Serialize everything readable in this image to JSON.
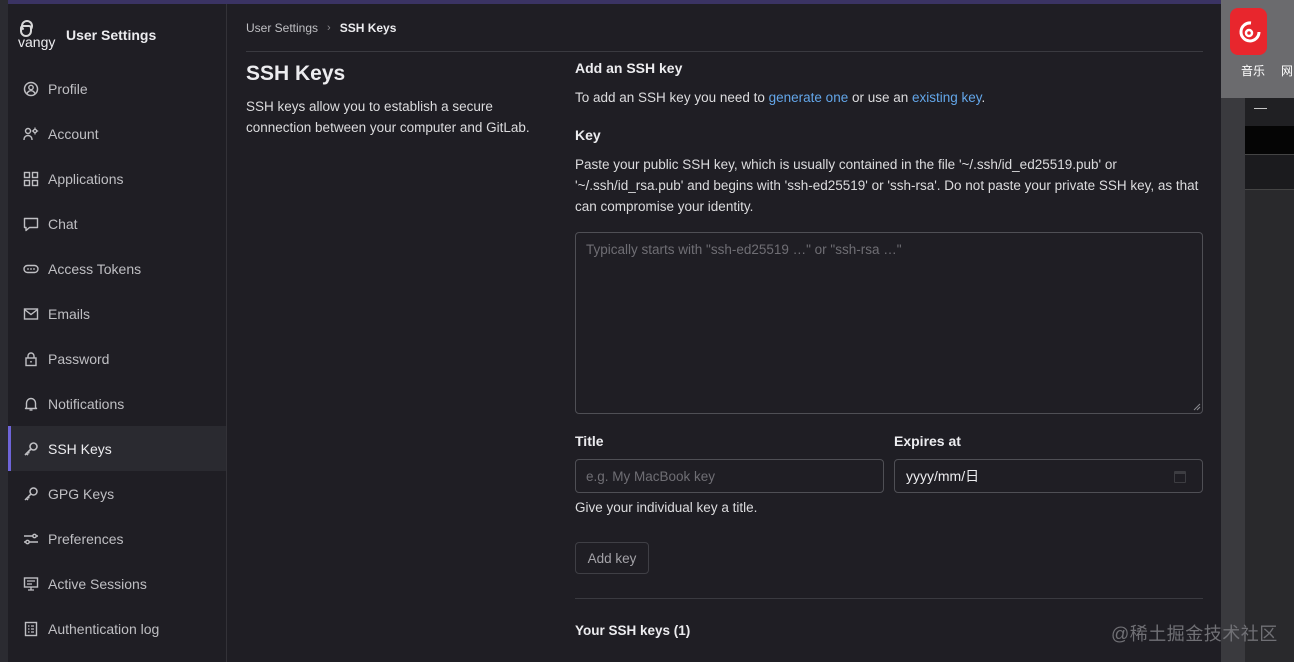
{
  "sidebar": {
    "avatar_alt": "vangy",
    "title": "User Settings",
    "items": [
      {
        "label": "Profile",
        "icon": "profile-icon"
      },
      {
        "label": "Account",
        "icon": "account-icon"
      },
      {
        "label": "Applications",
        "icon": "applications-icon"
      },
      {
        "label": "Chat",
        "icon": "chat-icon"
      },
      {
        "label": "Access Tokens",
        "icon": "token-icon"
      },
      {
        "label": "Emails",
        "icon": "mail-icon"
      },
      {
        "label": "Password",
        "icon": "lock-icon"
      },
      {
        "label": "Notifications",
        "icon": "bell-icon"
      },
      {
        "label": "SSH Keys",
        "icon": "key-icon",
        "active": true
      },
      {
        "label": "GPG Keys",
        "icon": "key-icon"
      },
      {
        "label": "Preferences",
        "icon": "preferences-icon"
      },
      {
        "label": "Active Sessions",
        "icon": "monitor-icon"
      },
      {
        "label": "Authentication log",
        "icon": "log-icon"
      }
    ]
  },
  "breadcrumb": {
    "parent": "User Settings",
    "current": "SSH Keys"
  },
  "page": {
    "title": "SSH Keys",
    "description": "SSH keys allow you to establish a secure connection between your computer and GitLab."
  },
  "form": {
    "heading": "Add an SSH key",
    "intro_prefix": "To add an SSH key you need to ",
    "intro_link1": "generate one",
    "intro_mid": " or use an ",
    "intro_link2": "existing key",
    "intro_suffix": ".",
    "key_label": "Key",
    "key_help": "Paste your public SSH key, which is usually contained in the file '~/.ssh/id_ed25519.pub' or '~/.ssh/id_rsa.pub' and begins with 'ssh-ed25519' or 'ssh-rsa'. Do not paste your private SSH key, as that can compromise your identity.",
    "key_placeholder": "Typically starts with \"ssh-ed25519 …\" or \"ssh-rsa …\"",
    "title_label": "Title",
    "title_placeholder": "e.g. My MacBook key",
    "expires_label": "Expires at",
    "expires_value": "yyyy/mm/日",
    "title_help": "Give your individual key a title.",
    "submit_label": "Add key",
    "your_keys": "Your SSH keys (1)"
  },
  "desktop": {
    "app_caption": "音乐",
    "app_caption2": "网",
    "dash": "—"
  },
  "watermark": "@稀土掘金技术社区",
  "colors": {
    "background": "#1f1e24",
    "accent": "#6e64d8",
    "link": "#63a6e9"
  }
}
